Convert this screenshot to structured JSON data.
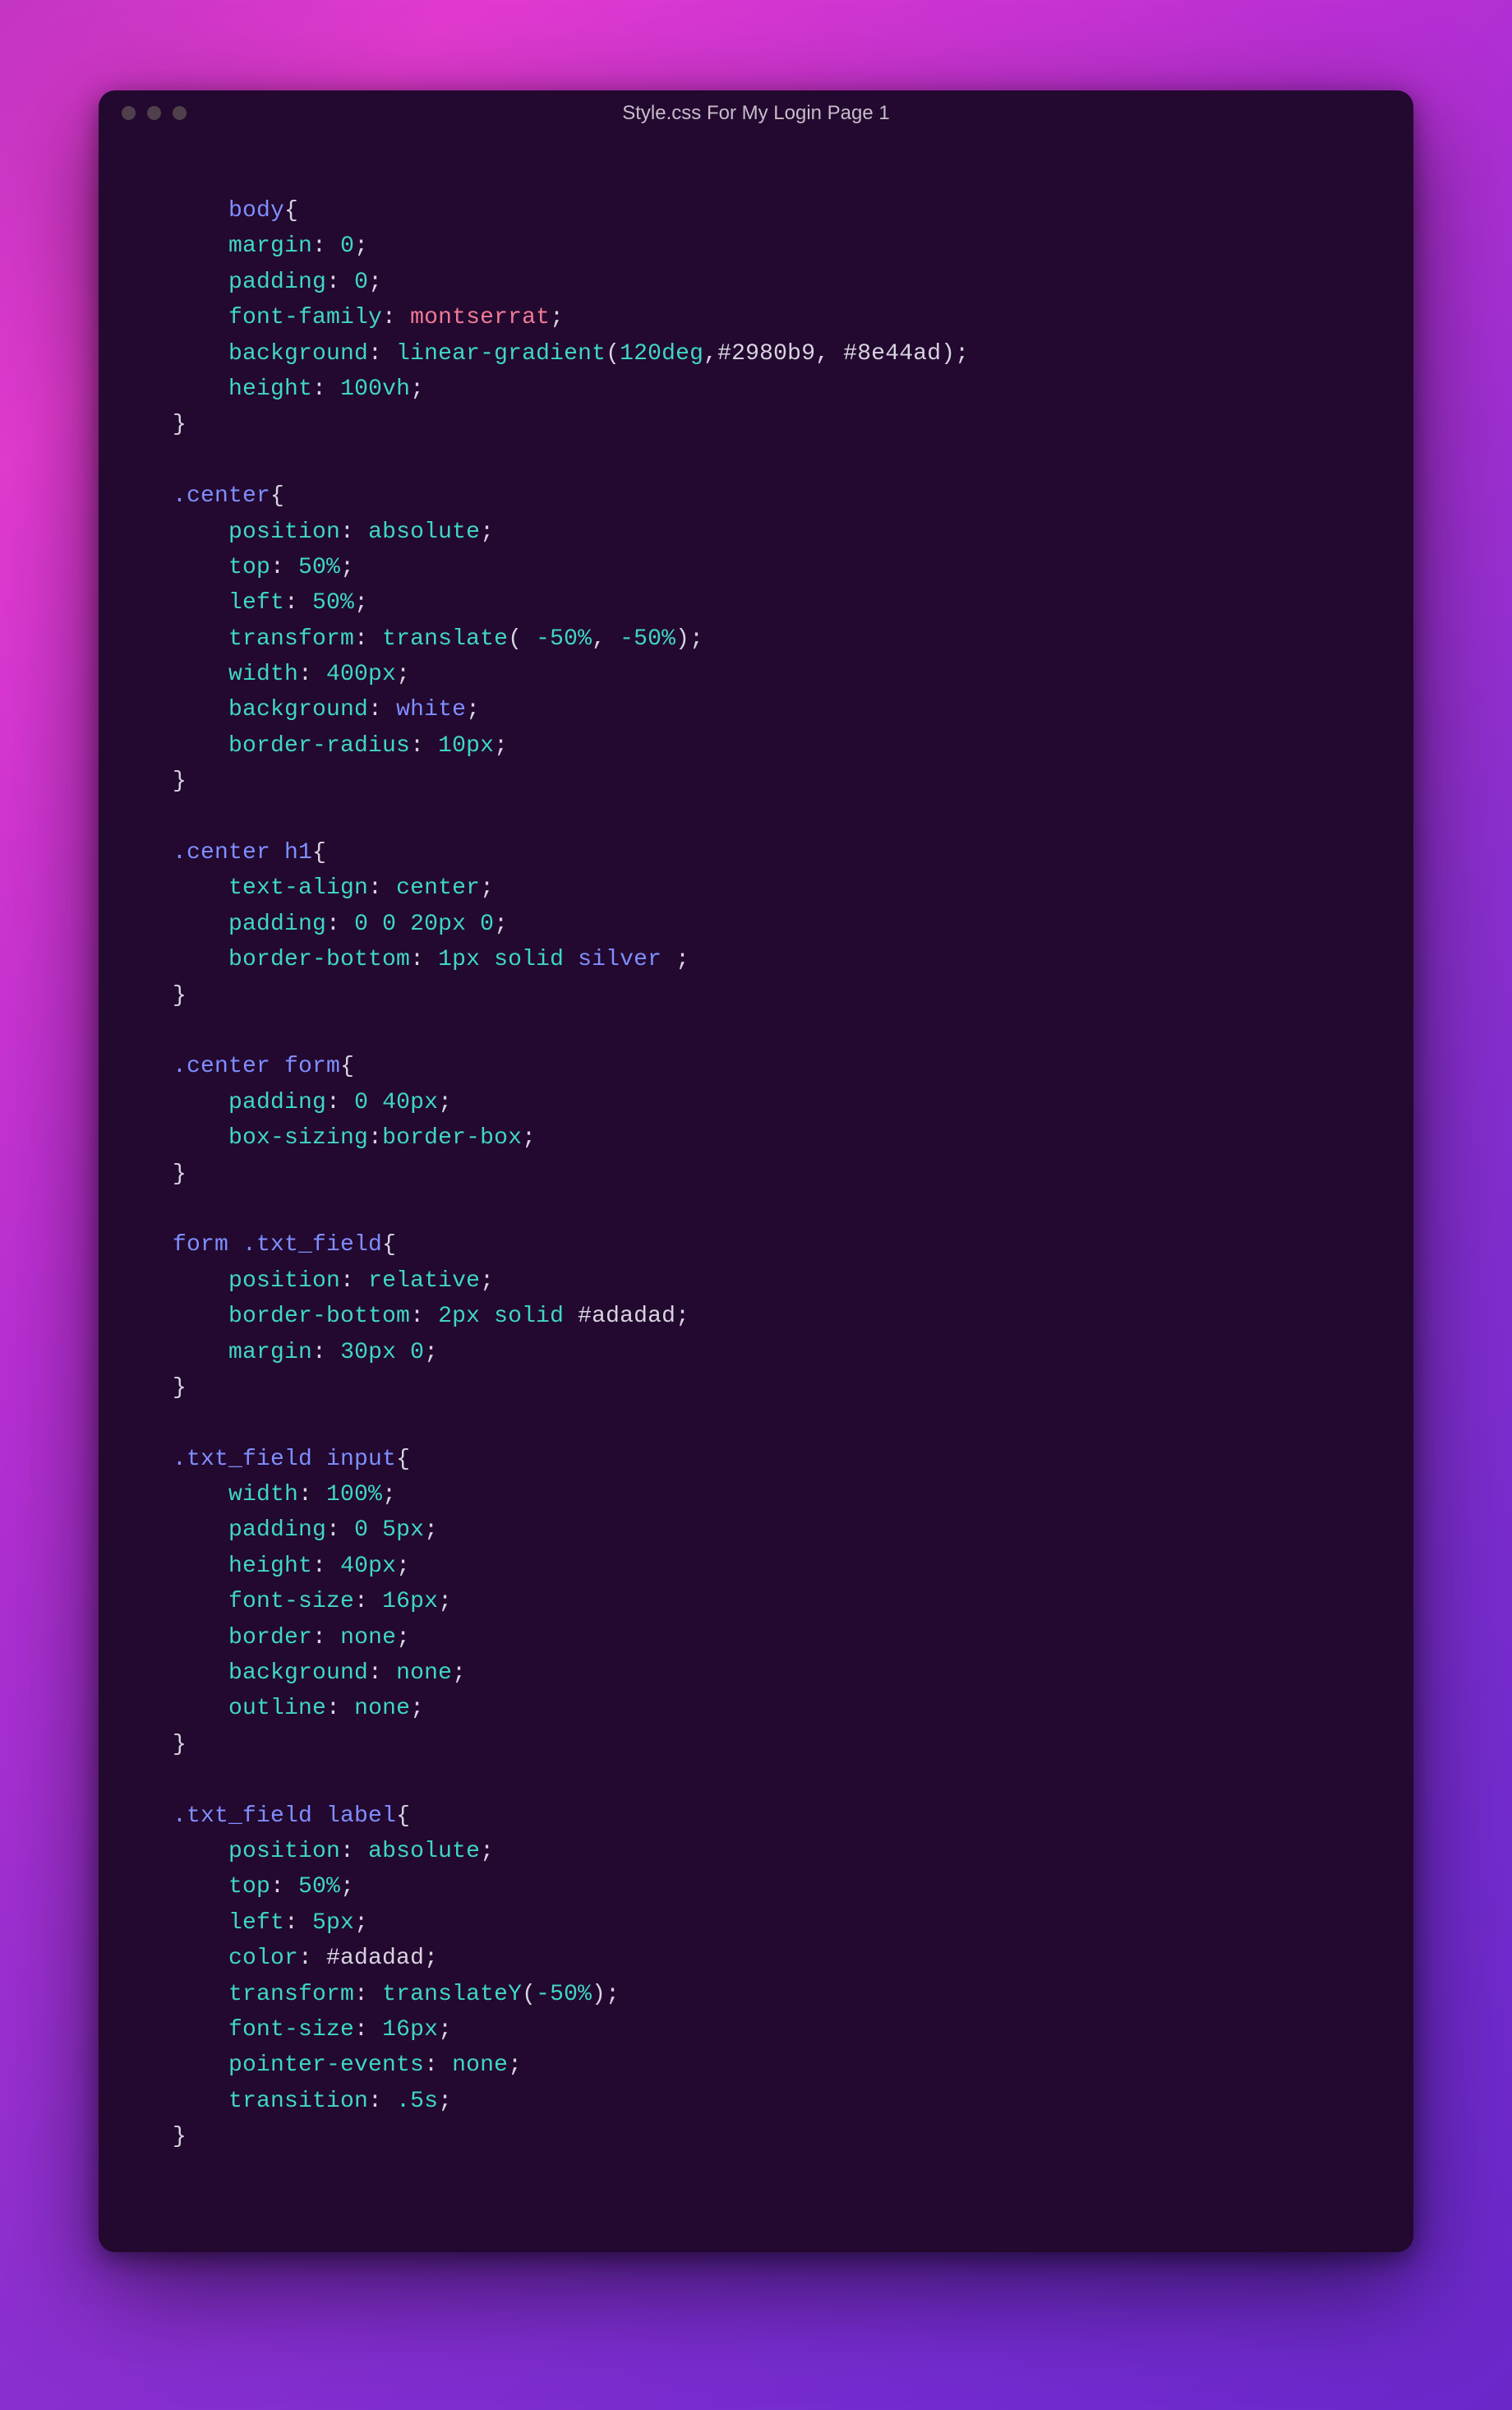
{
  "window": {
    "title": "Style.css For My Login Page 1"
  },
  "code": {
    "rules": [
      {
        "selector": "body",
        "selectorClass": "sel",
        "indentSelector": 1,
        "decls": [
          {
            "prop": "margin",
            "value": [
              {
                "t": "0",
                "c": "num"
              }
            ]
          },
          {
            "prop": "padding",
            "value": [
              {
                "t": "0",
                "c": "num"
              }
            ]
          },
          {
            "prop": "font-family",
            "value": [
              {
                "t": "montserrat",
                "c": "named1"
              }
            ]
          },
          {
            "prop": "background",
            "value": [
              {
                "t": "linear-gradient",
                "c": "fn"
              },
              {
                "t": "(",
                "c": "punc"
              },
              {
                "t": "120deg",
                "c": "num"
              },
              {
                "t": ",",
                "c": "punc"
              },
              {
                "t": "#2980b9",
                "c": "hex"
              },
              {
                "t": ", ",
                "c": "punc"
              },
              {
                "t": "#8e44ad",
                "c": "hex"
              },
              {
                "t": ")",
                "c": "punc"
              }
            ]
          },
          {
            "prop": "height",
            "value": [
              {
                "t": "100vh",
                "c": "num"
              }
            ]
          }
        ]
      },
      {
        "selector": ".center",
        "selectorClass": "sel",
        "decls": [
          {
            "prop": "position",
            "value": [
              {
                "t": "absolute",
                "c": "val"
              }
            ]
          },
          {
            "prop": "top",
            "value": [
              {
                "t": "50%",
                "c": "num"
              }
            ]
          },
          {
            "prop": "left",
            "value": [
              {
                "t": "50%",
                "c": "num"
              }
            ]
          },
          {
            "prop": "transform",
            "value": [
              {
                "t": "translate",
                "c": "fn"
              },
              {
                "t": "( ",
                "c": "punc"
              },
              {
                "t": "-50%",
                "c": "num"
              },
              {
                "t": ", ",
                "c": "punc"
              },
              {
                "t": "-50%",
                "c": "num"
              },
              {
                "t": ")",
                "c": "punc"
              }
            ]
          },
          {
            "prop": "width",
            "value": [
              {
                "t": "400px",
                "c": "num"
              }
            ]
          },
          {
            "prop": "background",
            "value": [
              {
                "t": "white",
                "c": "named2"
              }
            ]
          },
          {
            "prop": "border-radius",
            "value": [
              {
                "t": "10px",
                "c": "num"
              }
            ]
          }
        ]
      },
      {
        "selector": ".center h1",
        "selectorParts": [
          {
            "t": ".center",
            "c": "sel"
          },
          {
            "t": " ",
            "c": "punc"
          },
          {
            "t": "h1",
            "c": "ident"
          }
        ],
        "decls": [
          {
            "prop": "text-align",
            "value": [
              {
                "t": "center",
                "c": "val"
              }
            ]
          },
          {
            "prop": "padding",
            "value": [
              {
                "t": "0 0 20px 0",
                "c": "num"
              }
            ]
          },
          {
            "prop": "border-bottom",
            "value": [
              {
                "t": "1px solid",
                "c": "num"
              },
              {
                "t": " ",
                "c": "punc"
              },
              {
                "t": "silver",
                "c": "named2"
              },
              {
                "t": " ",
                "c": "punc"
              }
            ]
          }
        ]
      },
      {
        "selector": ".center form",
        "selectorParts": [
          {
            "t": ".center",
            "c": "sel"
          },
          {
            "t": " ",
            "c": "punc"
          },
          {
            "t": "form",
            "c": "ident"
          }
        ],
        "decls": [
          {
            "prop": "padding",
            "value": [
              {
                "t": "0 40px",
                "c": "num"
              }
            ]
          },
          {
            "prop": "box-sizing",
            "noSpace": true,
            "value": [
              {
                "t": "border-box",
                "c": "val"
              }
            ]
          }
        ]
      },
      {
        "selector": "form .txt_field",
        "selectorParts": [
          {
            "t": "form",
            "c": "ident"
          },
          {
            "t": " ",
            "c": "punc"
          },
          {
            "t": ".txt_field",
            "c": "sel"
          }
        ],
        "decls": [
          {
            "prop": "position",
            "value": [
              {
                "t": "relative",
                "c": "val"
              }
            ]
          },
          {
            "prop": "border-bottom",
            "value": [
              {
                "t": "2px solid",
                "c": "num"
              },
              {
                "t": " ",
                "c": "punc"
              },
              {
                "t": "#adadad",
                "c": "hex"
              }
            ]
          },
          {
            "prop": "margin",
            "value": [
              {
                "t": "30px 0",
                "c": "num"
              }
            ]
          }
        ]
      },
      {
        "selector": ".txt_field input",
        "selectorParts": [
          {
            "t": ".txt_field",
            "c": "sel"
          },
          {
            "t": " ",
            "c": "punc"
          },
          {
            "t": "input",
            "c": "ident"
          }
        ],
        "decls": [
          {
            "prop": "width",
            "value": [
              {
                "t": "100%",
                "c": "num"
              }
            ]
          },
          {
            "prop": "padding",
            "value": [
              {
                "t": "0 5px",
                "c": "num"
              }
            ]
          },
          {
            "prop": "height",
            "value": [
              {
                "t": "40px",
                "c": "num"
              }
            ]
          },
          {
            "prop": "font-size",
            "value": [
              {
                "t": "16px",
                "c": "num"
              }
            ]
          },
          {
            "prop": "border",
            "value": [
              {
                "t": "none",
                "c": "val"
              }
            ]
          },
          {
            "prop": "background",
            "value": [
              {
                "t": "none",
                "c": "val"
              }
            ]
          },
          {
            "prop": "outline",
            "value": [
              {
                "t": "none",
                "c": "val"
              }
            ]
          }
        ]
      },
      {
        "selector": ".txt_field label",
        "selectorParts": [
          {
            "t": ".txt_field",
            "c": "sel"
          },
          {
            "t": " ",
            "c": "punc"
          },
          {
            "t": "label",
            "c": "ident"
          }
        ],
        "decls": [
          {
            "prop": "position",
            "value": [
              {
                "t": "absolute",
                "c": "val"
              }
            ]
          },
          {
            "prop": "top",
            "value": [
              {
                "t": "50%",
                "c": "num"
              }
            ]
          },
          {
            "prop": "left",
            "value": [
              {
                "t": "5px",
                "c": "num"
              }
            ]
          },
          {
            "prop": "color",
            "value": [
              {
                "t": "#adadad",
                "c": "hex"
              }
            ]
          },
          {
            "prop": "transform",
            "value": [
              {
                "t": "translateY",
                "c": "fn"
              },
              {
                "t": "(",
                "c": "punc"
              },
              {
                "t": "-50%",
                "c": "num"
              },
              {
                "t": ")",
                "c": "punc"
              }
            ]
          },
          {
            "prop": "font-size",
            "value": [
              {
                "t": "16px",
                "c": "num"
              }
            ]
          },
          {
            "prop": "pointer-events",
            "value": [
              {
                "t": "none",
                "c": "val"
              }
            ]
          },
          {
            "prop": "transition",
            "value": [
              {
                "t": ".5s",
                "c": "num"
              }
            ]
          }
        ]
      }
    ]
  }
}
